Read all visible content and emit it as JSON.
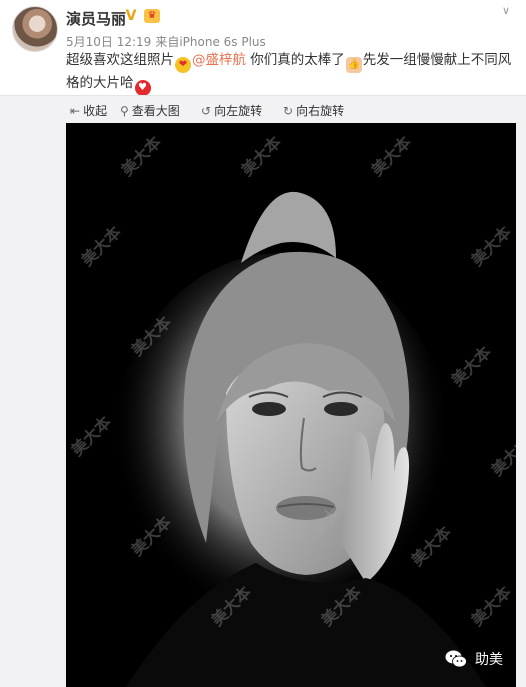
{
  "post": {
    "user_name": "演员马丽",
    "verified_badge": "V",
    "vip_badge": "会员",
    "date": "5月10日 12:19",
    "source_prefix": "来自",
    "source": "iPhone 6s Plus",
    "text_part1": "超级喜欢这组照片",
    "mention": "@盛梓航",
    "text_part2": " 你们真的太棒了",
    "text_part3": "先发一组慢慢献上不同风格的大片哈",
    "icons": {
      "heart_eyes": "heart-eyes-emoji",
      "thumbs_up": "thumbs-up-emoji",
      "heart": "heart-emoji"
    }
  },
  "toolbar": {
    "collapse": "收起",
    "view_large": "查看大图",
    "rotate_left": "向左旋转",
    "rotate_right": "向右旋转"
  },
  "photo": {
    "watermark": "美大本",
    "brand": "助美"
  }
}
